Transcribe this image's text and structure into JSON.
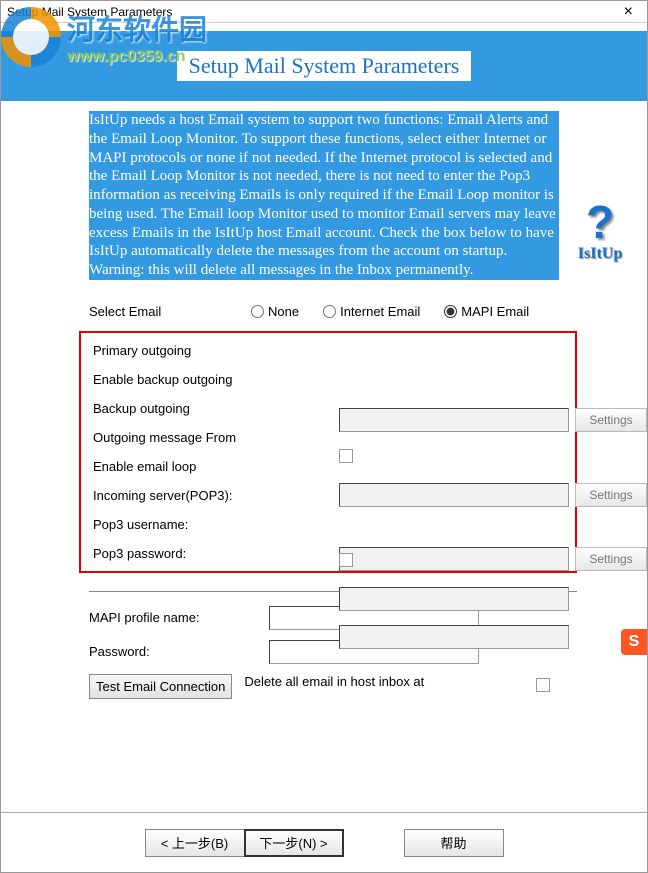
{
  "window": {
    "title": "Setup Mail System Parameters",
    "close": "×"
  },
  "watermark": {
    "line1": "河东软件园",
    "line2": "www.pc0359.cn"
  },
  "header": {
    "title": "Setup Mail System Parameters"
  },
  "description": "IsItUp needs a host Email system to support two functions: Email Alerts and the Email Loop Monitor. To support these functions, select either Internet or MAPI protocols or none if not needed. If the Internet protocol is selected and the Email Loop Monitor is not needed, there is not need to enter the Pop3 information as receiving Emails is only required if the Email Loop monitor is being used. The Email loop Monitor used to monitor Email servers may leave excess Emails in the IsItUp host Email account. Check the box below to have IsItUp automatically delete the messages from the account on startup. Warning: this will delete all messages in the Inbox permanently.",
  "help": {
    "mark": "?",
    "text": "IsItUp"
  },
  "selectEmail": {
    "label": "Select Email",
    "options": {
      "none": "None",
      "internet": "Internet Email",
      "mapi": "MAPI Email"
    },
    "selected": "mapi"
  },
  "fields": {
    "primaryOutgoing": "Primary outgoing",
    "enableBackup": "Enable backup outgoing",
    "backupOutgoing": "Backup outgoing",
    "outgoingFrom": "Outgoing message From",
    "enableLoop": "Enable email loop",
    "incomingPop3": "Incoming server(POP3):",
    "pop3User": "Pop3 username:",
    "pop3Pass": "Pop3 password:",
    "mapiProfile": "MAPI profile name:",
    "password": "Password:"
  },
  "buttons": {
    "settings": "Settings",
    "test": "Test Email Connection",
    "deleteAll": "Delete all email in host inbox at",
    "prev": "< 上一步(B)",
    "next": "下一步(N) >",
    "help": "帮助"
  },
  "sideWidget": "S"
}
